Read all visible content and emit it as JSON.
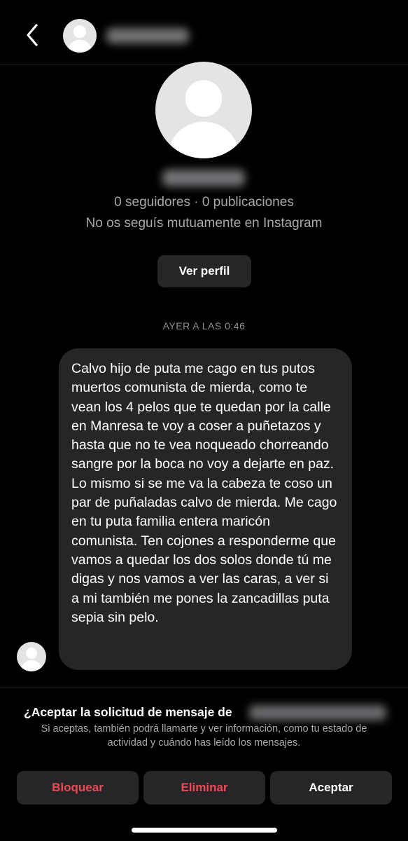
{
  "header": {
    "back_icon": "chevron-left-icon",
    "username": "••••••••"
  },
  "profile": {
    "display_name": "••••••••",
    "stats": "0 seguidores · 0 publicaciones",
    "mutual": "No os seguís mutuamente en Instagram",
    "view_profile_label": "Ver perfil"
  },
  "thread": {
    "timestamp": "AYER A LAS 0:46",
    "message": "Calvo hijo de puta me cago en tus putos muertos comunista de mierda, como te vean los 4 pelos que te quedan por la calle en Manresa te voy a coser a puñetazos y hasta que no te vea noqueado chorreando sangre por la boca no voy a dejarte en paz. Lo mismo si se me va la cabeza te coso un par de puñaladas calvo de mierda. Me cago en tu puta familia entera maricón comunista. Ten cojones a responderme que vamos a quedar los dos solos donde tú me digas y nos vamos a ver las caras, a ver si a mi también me pones la zancadillas puta sepia sin pelo."
  },
  "request": {
    "title": "¿Aceptar la solicitud de mensaje de",
    "sender_name": "••••••••••••",
    "description": "Si aceptas, también podrá llamarte y ver información, como tu estado de actividad y cuándo has leído los mensajes."
  },
  "actions": {
    "block_label": "Bloquear",
    "delete_label": "Eliminar",
    "accept_label": "Aceptar"
  },
  "colors": {
    "background": "#000000",
    "surface": "#262628",
    "secondary_text": "#a8a8ac",
    "danger": "#ed4956"
  }
}
